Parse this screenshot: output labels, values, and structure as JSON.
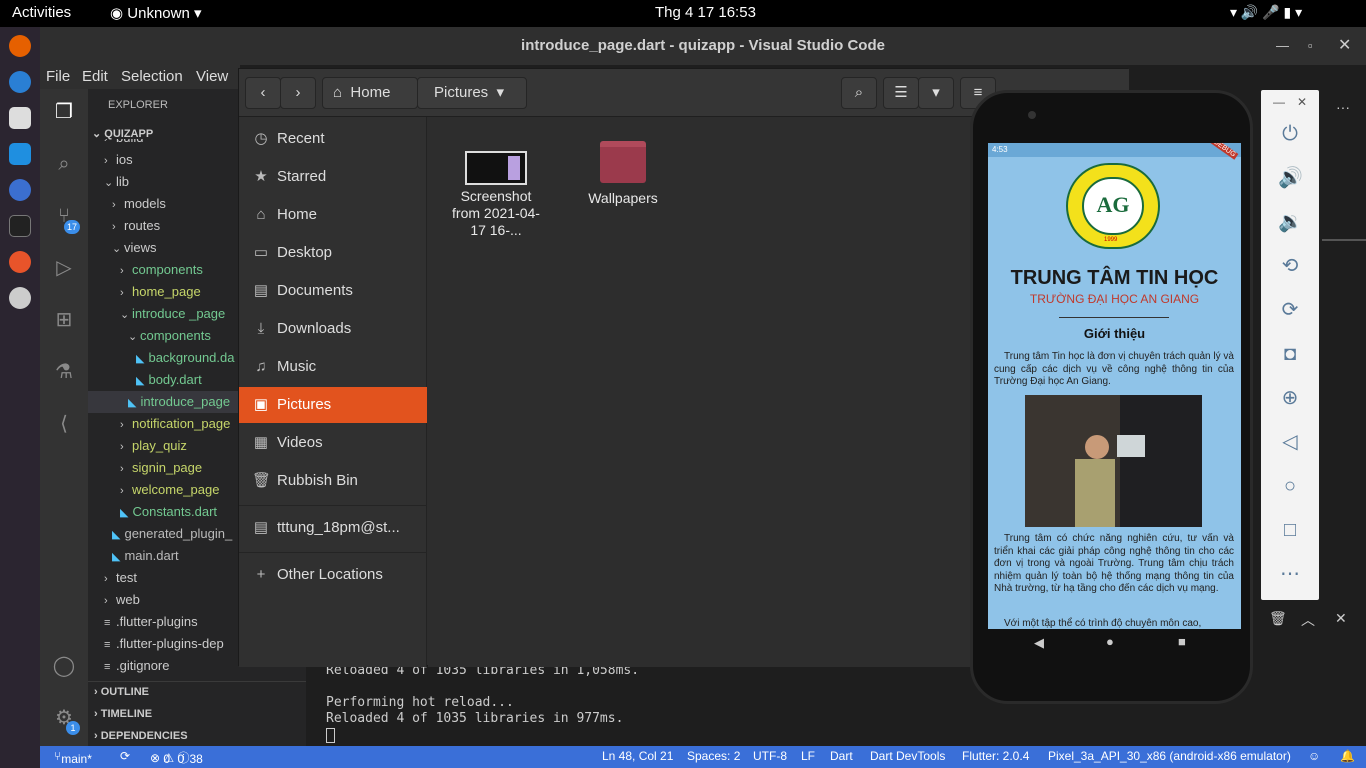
{
  "topbar": {
    "activities": "Activities",
    "app_menu": "Unknown",
    "datetime": "Thg 4 17  16:53"
  },
  "vscode": {
    "title": "introduce_page.dart - quizapp - Visual Studio Code",
    "menu": [
      "File",
      "Edit",
      "Selection",
      "View"
    ],
    "explorer_title": "EXPLORER",
    "project": "QUIZAPP",
    "tree": [
      {
        "label": "build",
        "indent": 1,
        "type": "folder"
      },
      {
        "label": "ios",
        "indent": 1,
        "type": "folder"
      },
      {
        "label": "lib",
        "indent": 1,
        "type": "folder-open"
      },
      {
        "label": "models",
        "indent": 2,
        "type": "folder"
      },
      {
        "label": "routes",
        "indent": 2,
        "type": "folder"
      },
      {
        "label": "views",
        "indent": 2,
        "type": "folder-open"
      },
      {
        "label": "components",
        "indent": 3,
        "type": "folder"
      },
      {
        "label": "home_page",
        "indent": 3,
        "type": "folder"
      },
      {
        "label": "introduce _page",
        "indent": 3,
        "type": "folder-open"
      },
      {
        "label": "components",
        "indent": 4,
        "type": "folder-open"
      },
      {
        "label": "background.da",
        "indent": 5,
        "type": "dart"
      },
      {
        "label": "body.dart",
        "indent": 5,
        "type": "dart"
      },
      {
        "label": "introduce_page",
        "indent": 4,
        "type": "dart"
      },
      {
        "label": "notification_page",
        "indent": 3,
        "type": "folder"
      },
      {
        "label": "play_quiz",
        "indent": 3,
        "type": "folder"
      },
      {
        "label": "signin_page",
        "indent": 3,
        "type": "folder"
      },
      {
        "label": "welcome_page",
        "indent": 3,
        "type": "folder"
      },
      {
        "label": "Constants.dart",
        "indent": 3,
        "type": "dart"
      },
      {
        "label": "generated_plugin_",
        "indent": 2,
        "type": "dart"
      },
      {
        "label": "main.dart",
        "indent": 2,
        "type": "dart"
      },
      {
        "label": "test",
        "indent": 1,
        "type": "folder"
      },
      {
        "label": "web",
        "indent": 1,
        "type": "folder"
      },
      {
        "label": ".flutter-plugins",
        "indent": 1,
        "type": "file"
      },
      {
        "label": ".flutter-plugins-dep",
        "indent": 1,
        "type": "file"
      },
      {
        "label": ".gitignore",
        "indent": 1,
        "type": "file"
      }
    ],
    "sections": [
      "OUTLINE",
      "TIMELINE",
      "DEPENDENCIES"
    ],
    "scm_badge": "17",
    "settings_badge": "1",
    "terminal": [
      "Reloaded 4 of 1035 libraries in 1,058ms.",
      "",
      "Performing hot reload...",
      "Reloaded 4 of 1035 libraries in 977ms."
    ],
    "status": {
      "branch": "main*",
      "problems": "0",
      "warnings": "0",
      "info": "38",
      "position": "Ln 48, Col 21",
      "spaces": "Spaces: 2",
      "encoding": "UTF-8",
      "eol": "LF",
      "language": "Dart",
      "devtools": "Dart DevTools",
      "flutter": "Flutter: 2.0.4",
      "device": "Pixel_3a_API_30_x86 (android-x86 emulator)"
    }
  },
  "files": {
    "path_home": "Home",
    "path_current": "Pictures",
    "sidebar": [
      {
        "icon": "recent-icon",
        "label": "Recent"
      },
      {
        "icon": "star-icon",
        "label": "Starred"
      },
      {
        "icon": "home-icon",
        "label": "Home"
      },
      {
        "icon": "desktop-icon",
        "label": "Desktop"
      },
      {
        "icon": "documents-icon",
        "label": "Documents"
      },
      {
        "icon": "downloads-icon",
        "label": "Downloads"
      },
      {
        "icon": "music-icon",
        "label": "Music"
      },
      {
        "icon": "pictures-icon",
        "label": "Pictures"
      },
      {
        "icon": "videos-icon",
        "label": "Videos"
      },
      {
        "icon": "trash-icon",
        "label": "Rubbish Bin"
      },
      {
        "icon": "drive-icon",
        "label": "tttung_18pm@st..."
      },
      {
        "icon": "plus-icon",
        "label": "Other Locations"
      }
    ],
    "items": [
      {
        "label": "Screenshot from 2021-04-17 16-..."
      },
      {
        "label": "Wallpapers"
      }
    ]
  },
  "phone": {
    "time": "4:53",
    "header_title": "TRUNG TÂM TIN HỌC",
    "header_subtitle": "TRƯỜNG ĐẠI HỌC AN GIANG",
    "section": "Giới thiệu",
    "para1": "Trung tâm Tin học là đơn vị chuyên trách quản lý và cung cấp các dịch vụ về công nghệ thông tin của Trường Đại học An Giang.",
    "para2": "Trung tâm có chức năng nghiên cứu, tư vấn và triển khai các giải pháp công nghệ thông tin cho các đơn vị trong và ngoài Trường. Trung tâm chịu trách nhiệm quản lý toàn bộ hệ thống mạng thông tin của Nhà trường, từ hạ tầng cho đến các dịch vụ mạng.",
    "para3": "Với một tập thể có trình độ chuyên môn cao,",
    "logo_year": "1999",
    "debug": "DEBUG"
  }
}
